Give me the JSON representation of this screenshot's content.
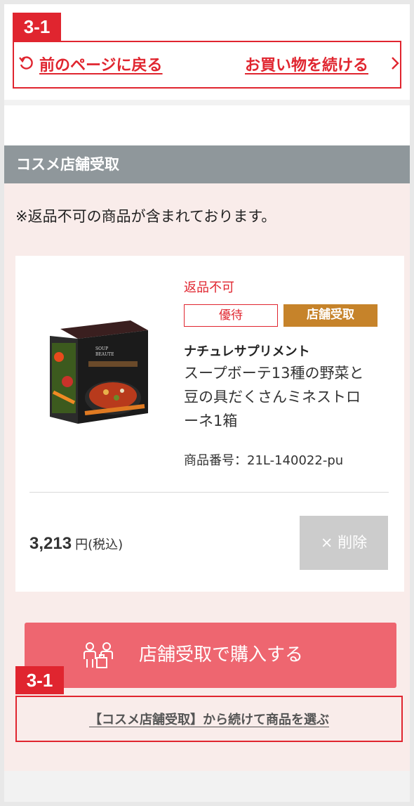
{
  "annotations": {
    "tag_top": "3-1",
    "tag_bottom": "3-1"
  },
  "nav": {
    "back_label": "前のページに戻る",
    "continue_shopping_label": "お買い物を続ける"
  },
  "section": {
    "title": "コスメ店舗受取"
  },
  "notice": "※返品不可の商品が含まれております。",
  "item": {
    "return_status": "返品不可",
    "badges": [
      "優待",
      "店舗受取"
    ],
    "brand": "ナチュレサプリメント",
    "name_line1": "スープボーテ13種の野菜と",
    "name_line2": "豆の具だくさんミネストロ",
    "name_line3": "ーネ1箱",
    "code": "商品番号：21L-140022-pu",
    "price": "3,213",
    "price_unit": "円(税込)",
    "delete_label": "× 削除"
  },
  "actions": {
    "buy_label": "店舗受取で購入する",
    "continue_label": "【コスメ店舗受取】から続けて商品を選ぶ"
  },
  "colors": {
    "accent": "#e0252f",
    "buy_button": "#ee6670",
    "store_badge": "#c6832a",
    "section_header": "#8f979b"
  },
  "icons": {
    "back": "refresh-icon",
    "forward": "chevron-right-icon",
    "buy": "people-bag-icon"
  }
}
